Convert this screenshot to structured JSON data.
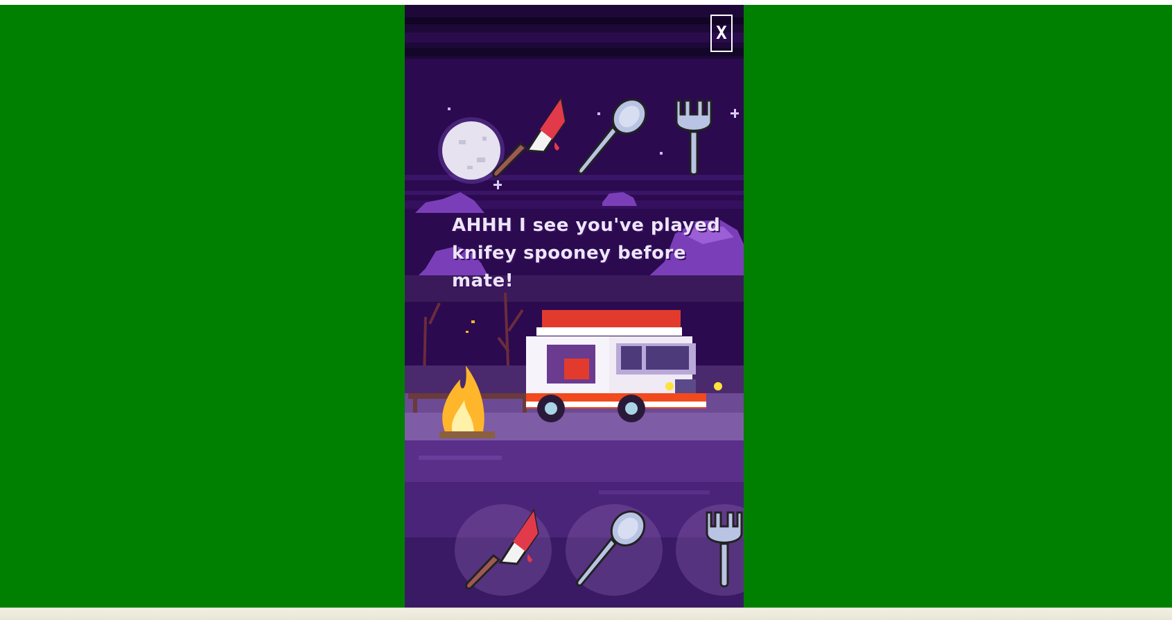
{
  "game": {
    "close_label": "X",
    "dialog_text": "AHHH I see you've played knifey spooney before mate!",
    "opponent_hand": [
      {
        "name": "knife",
        "icon": "bloody-knife-icon"
      },
      {
        "name": "spoon",
        "icon": "spoon-icon"
      },
      {
        "name": "fork",
        "icon": "fork-icon"
      }
    ],
    "player_choices": [
      {
        "name": "knife",
        "icon": "bloody-knife-icon"
      },
      {
        "name": "spoon",
        "icon": "spoon-icon"
      },
      {
        "name": "fork",
        "icon": "fork-icon"
      }
    ]
  },
  "colors": {
    "page_background": "#008000",
    "sky": "#2a0a4e",
    "dialog_text": "#ece6f7",
    "blade_blood": "#e23a4a",
    "utensil_metal": "#b9c4e4"
  }
}
